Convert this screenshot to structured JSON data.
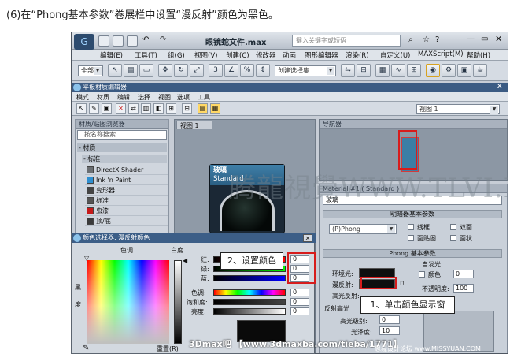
{
  "caption": "(6)在“Phong基本参数”卷展栏中设置“漫反射”颜色为黑色。",
  "window": {
    "title": "眼镜蛇文件.max",
    "search_placeholder": "键入关键字或短语"
  },
  "menubar": [
    "编辑(E)",
    "工具(T)",
    "组(G)",
    "视图(V)",
    "创建(C)",
    "修改器",
    "动画",
    "图形编辑器",
    "渲染(R)",
    "自定义(U)",
    "MAXScript(M)",
    "帮助(H)"
  ],
  "toolbar": {
    "all_dropdown": "全部",
    "selection_set_dropdown": "创建选择集"
  },
  "slate": {
    "title": "平板材质编辑器",
    "menu": [
      "模式",
      "材质",
      "编辑",
      "选择",
      "视图",
      "选项",
      "工具"
    ],
    "view_dropdown": "视图 1"
  },
  "browser": {
    "header": "材质/贴图浏览器",
    "search_placeholder": "按名称搜索...",
    "group_materials": "- 材质",
    "group_standard": "- 标准",
    "items": [
      "DirectX Shader",
      "Ink 'n Paint",
      "变形器",
      "标准",
      "虫漆",
      "顶/底"
    ]
  },
  "view_tab": "视图 1",
  "node": {
    "name": "玻璃",
    "type": "Standard"
  },
  "navigator": {
    "header": "导航器"
  },
  "material": {
    "header": "Material #1 ( Standard )",
    "name_value": "玻璃",
    "shader_section": "明暗器基本参数",
    "shader_dropdown": "(P)Phong",
    "wire": "线框",
    "two_sided": "双面",
    "face_map": "面贴图",
    "faceted": "面状",
    "phong_section": "Phong 基本参数",
    "self_illum": "自发光",
    "color_check": "颜色",
    "self_illum_value": "0",
    "ambient": "环境光:",
    "diffuse": "漫反射:",
    "specular": "高光反射:",
    "opacity": "不透明度:",
    "opacity_value": "100",
    "spec_section": "反射高光",
    "spec_level": "高光级别:",
    "spec_level_value": "0",
    "glossiness": "光泽度:",
    "glossiness_value": "10"
  },
  "color_selector": {
    "title": "颜色选择器: 漫反射颜色",
    "hue": "色调",
    "whiteness": "白度",
    "blackness": "黑度",
    "red": "红:",
    "green": "绿:",
    "blue": "蓝:",
    "hue_label": "色调:",
    "saturation": "饱和度:",
    "value": "亮度:",
    "red_value": "0",
    "green_value": "0",
    "blue_value": "0",
    "hue_value": "0",
    "saturation_value": "0",
    "brightness_value": "0",
    "reset": "重置(R)"
  },
  "callouts": {
    "set_color": "2、设置颜色",
    "click_swatch": "1、单击颜色显示窗"
  },
  "watermark": "腾龍視覺WWW.TLVI.NET",
  "footer": "3Dmax吧 【www.3dmaxba.com/tieba/1771】",
  "footer_sub": "思缘设计论坛 www.MISSYUAN.COM"
}
